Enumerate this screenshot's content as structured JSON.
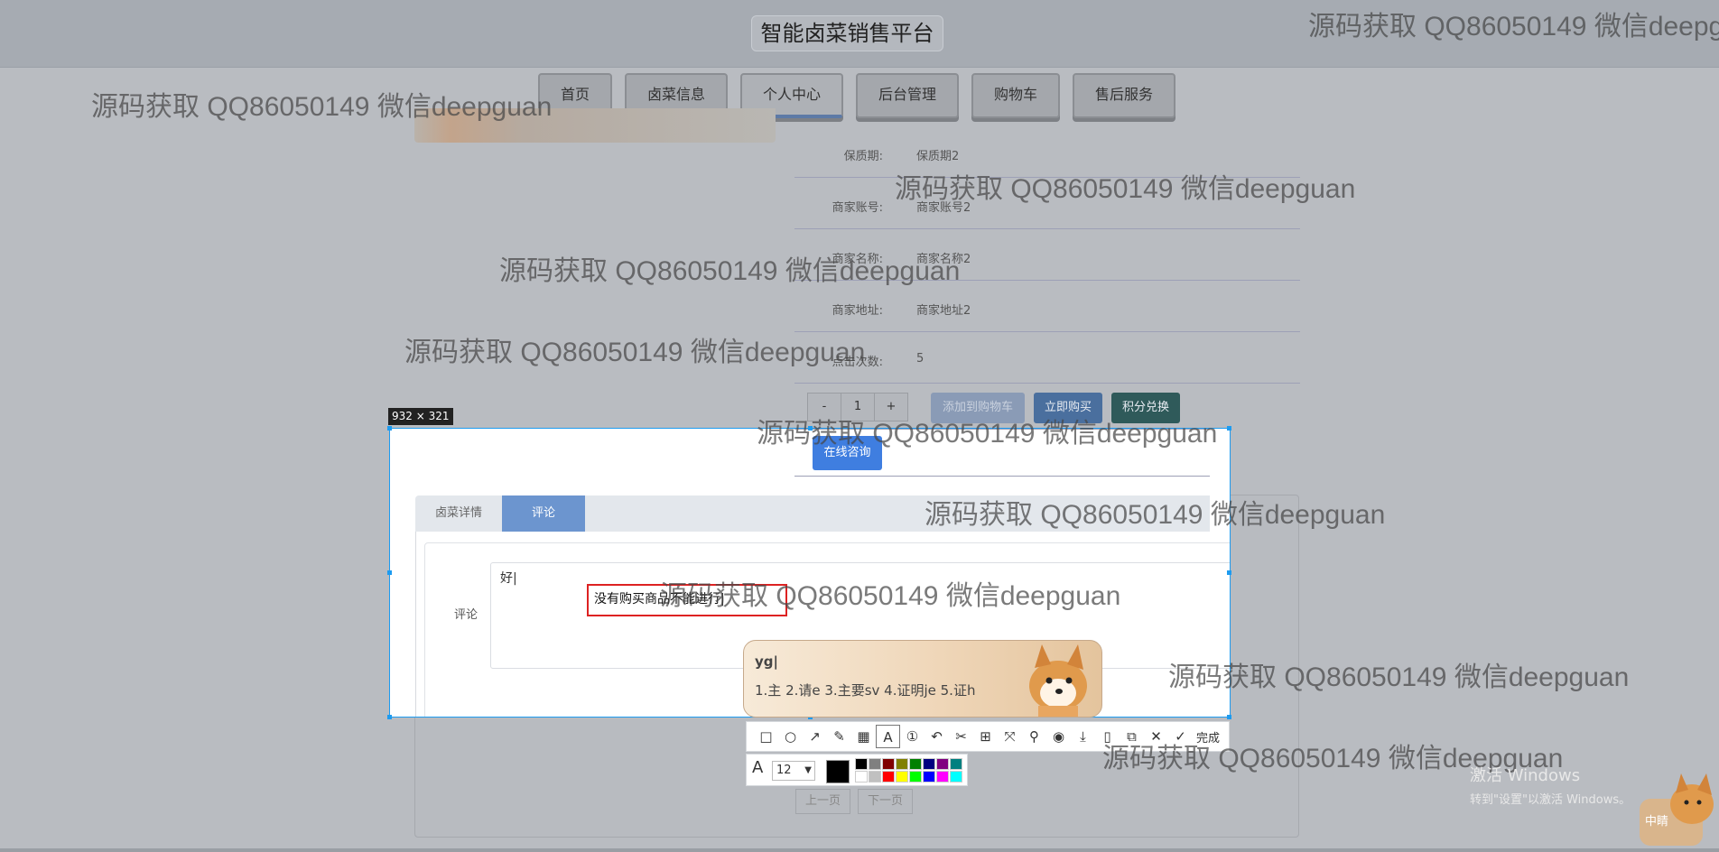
{
  "site": {
    "title": "智能卤菜销售平台"
  },
  "nav": {
    "items": [
      {
        "label": "首页"
      },
      {
        "label": "卤菜信息"
      },
      {
        "label": "个人中心"
      },
      {
        "label": "后台管理"
      },
      {
        "label": "购物车"
      },
      {
        "label": "售后服务"
      }
    ],
    "active_index": 2
  },
  "product_info": {
    "rows": [
      {
        "label": "保质期:",
        "value": "保质期2"
      },
      {
        "label": "商家账号:",
        "value": "商家账号2"
      },
      {
        "label": "商家名称:",
        "value": "商家名称2"
      },
      {
        "label": "商家地址:",
        "value": "商家地址2"
      },
      {
        "label": "点击次数:",
        "value": "5"
      }
    ]
  },
  "quantity": {
    "minus": "-",
    "value": "1",
    "plus": "+"
  },
  "actions": {
    "add_cart": "添加到购物车",
    "buy_now": "立即购买",
    "points_exchange": "积分兑换",
    "online_consult": "在线咨询"
  },
  "tabs": [
    {
      "label": "卤菜详情"
    },
    {
      "label": "评论"
    }
  ],
  "comment": {
    "label": "评论",
    "text": "好|",
    "tip": "没有购买商品不能进行|"
  },
  "pager": {
    "prev": "上一页",
    "next": "下一页"
  },
  "screenshot_tool": {
    "size_label": "932 × 321",
    "done_label": "完成",
    "font_size": "12",
    "font_icon": "A",
    "current_color": "#000000",
    "palette": [
      "#000000",
      "#808080",
      "#800000",
      "#808000",
      "#008000",
      "#000080",
      "#800080",
      "#008080",
      "#ffffff",
      "#c0c0c0",
      "#ff0000",
      "#ffff00",
      "#00ff00",
      "#0000ff",
      "#ff00ff",
      "#00ffff"
    ],
    "tools": [
      "rect-icon",
      "ellipse-icon",
      "arrow-icon",
      "pen-icon",
      "mosaic-icon",
      "text-icon",
      "number-icon",
      "undo-icon",
      "cutout-icon",
      "ocr-icon",
      "scroll-icon",
      "pin-icon",
      "record-icon",
      "download-icon",
      "save-icon",
      "copy-icon",
      "cancel-icon",
      "check-icon"
    ]
  },
  "ime": {
    "input": "yg|",
    "candidates": "1.主  2.请e  3.主要sv  4.证明je  5.证h"
  },
  "os_notice": {
    "line1": "激活 Windows",
    "line2": "转到\"设置\"以激活 Windows。",
    "badge": "中睛"
  },
  "watermark_text": "源码获取 QQ86050149 微信deepguan"
}
